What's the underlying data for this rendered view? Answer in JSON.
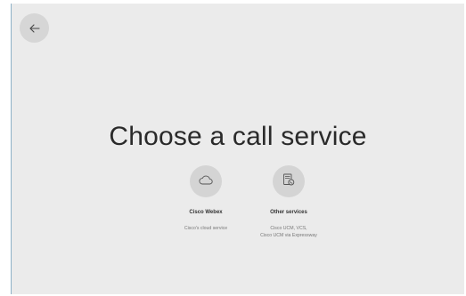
{
  "header": {
    "back_label": "Back"
  },
  "main": {
    "title": "Choose a call service",
    "options": [
      {
        "title": "Cisco Webex",
        "description": "Cisco's cloud service",
        "icon": "cloud-icon"
      },
      {
        "title": "Other services",
        "description_line1": "Cisco UCM, VCS,",
        "description_line2": "Cisco UCM via Expressway",
        "icon": "server-phone-icon"
      }
    ]
  },
  "colors": {
    "background": "#ebebeb",
    "icon_circle": "#d4d4d4",
    "back_circle": "#d6d6d6"
  }
}
